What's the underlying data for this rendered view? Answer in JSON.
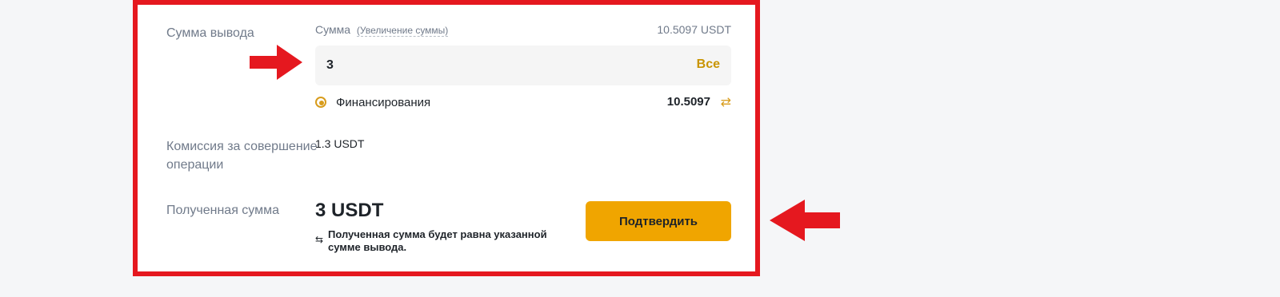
{
  "withdrawal": {
    "amount_label": "Сумма вывода",
    "amount_title": "Сумма",
    "increase_link": "(Увеличение суммы)",
    "available": "10.5097 USDT",
    "amount_value": "3",
    "max_label": "Все",
    "source_label": "Финансирования",
    "source_balance": "10.5097",
    "fee_label": "Комиссия за совершение операции",
    "fee_value": "1.3 USDT",
    "received_label": "Полученная сумма",
    "received_value": "3 USDT",
    "received_note": "Полученная сумма будет равна указанной сумме вывода.",
    "confirm_label": "Подтвердить"
  },
  "icons": {
    "transfer": "transfer-icon",
    "note": "swap-arrows-icon",
    "annotation_arrows": "red-arrow-icon"
  },
  "colors": {
    "highlight_border": "#e5181f",
    "accent": "#f0a500",
    "max_link": "#c99400"
  }
}
